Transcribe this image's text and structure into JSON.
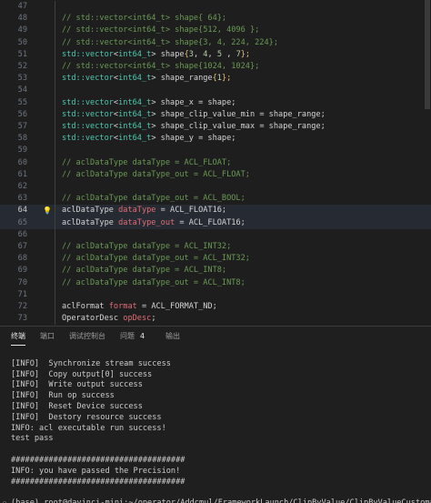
{
  "editor": {
    "lines": [
      {
        "num": "47",
        "tokens": []
      },
      {
        "num": "48",
        "tokens": [
          {
            "t": "// std::vector<int64_t> shape{ 64};",
            "c": "cm"
          }
        ]
      },
      {
        "num": "49",
        "tokens": [
          {
            "t": "// std::vector<int64_t> shape{512, 4096 };",
            "c": "cm"
          }
        ]
      },
      {
        "num": "50",
        "tokens": [
          {
            "t": "// std::vector<int64_t> shape{3, 4, 224, 224};",
            "c": "cm"
          }
        ]
      },
      {
        "num": "51",
        "tokens": [
          {
            "t": "std::",
            "c": "ns"
          },
          {
            "t": "vector",
            "c": "ty"
          },
          {
            "t": "<",
            "c": "pl"
          },
          {
            "t": "int64_t",
            "c": "ty"
          },
          {
            "t": "> ",
            "c": "pl"
          },
          {
            "t": "shape",
            "c": "pl"
          },
          {
            "t": "{",
            "c": "yl"
          },
          {
            "t": "3",
            "c": "nm"
          },
          {
            "t": ", ",
            "c": "pl"
          },
          {
            "t": "4",
            "c": "nm"
          },
          {
            "t": ", ",
            "c": "pl"
          },
          {
            "t": "5",
            "c": "nm"
          },
          {
            "t": " , ",
            "c": "pl"
          },
          {
            "t": "7",
            "c": "nm"
          },
          {
            "t": "};",
            "c": "yl"
          }
        ]
      },
      {
        "num": "52",
        "tokens": [
          {
            "t": "// std::vector<int64_t> shape{1024, 1024};",
            "c": "cm"
          }
        ]
      },
      {
        "num": "53",
        "tokens": [
          {
            "t": "std::",
            "c": "ns"
          },
          {
            "t": "vector",
            "c": "ty"
          },
          {
            "t": "<",
            "c": "pl"
          },
          {
            "t": "int64_t",
            "c": "ty"
          },
          {
            "t": "> ",
            "c": "pl"
          },
          {
            "t": "shape_range",
            "c": "pl"
          },
          {
            "t": "{",
            "c": "yl"
          },
          {
            "t": "1",
            "c": "nm"
          },
          {
            "t": "};",
            "c": "yl"
          }
        ]
      },
      {
        "num": "54",
        "tokens": []
      },
      {
        "num": "55",
        "tokens": [
          {
            "t": "std::",
            "c": "ns"
          },
          {
            "t": "vector",
            "c": "ty"
          },
          {
            "t": "<",
            "c": "pl"
          },
          {
            "t": "int64_t",
            "c": "ty"
          },
          {
            "t": "> shape_x = shape;",
            "c": "pl"
          }
        ]
      },
      {
        "num": "56",
        "tokens": [
          {
            "t": "std::",
            "c": "ns"
          },
          {
            "t": "vector",
            "c": "ty"
          },
          {
            "t": "<",
            "c": "pl"
          },
          {
            "t": "int64_t",
            "c": "ty"
          },
          {
            "t": "> shape_clip_value_min = shape_range;",
            "c": "pl"
          }
        ]
      },
      {
        "num": "57",
        "tokens": [
          {
            "t": "std::",
            "c": "ns"
          },
          {
            "t": "vector",
            "c": "ty"
          },
          {
            "t": "<",
            "c": "pl"
          },
          {
            "t": "int64_t",
            "c": "ty"
          },
          {
            "t": "> shape_clip_value_max = shape_range;",
            "c": "pl"
          }
        ]
      },
      {
        "num": "58",
        "tokens": [
          {
            "t": "std::",
            "c": "ns"
          },
          {
            "t": "vector",
            "c": "ty"
          },
          {
            "t": "<",
            "c": "pl"
          },
          {
            "t": "int64_t",
            "c": "ty"
          },
          {
            "t": "> shape_y = shape;",
            "c": "pl"
          }
        ]
      },
      {
        "num": "59",
        "tokens": []
      },
      {
        "num": "60",
        "tokens": [
          {
            "t": "// aclDataType dataType = ACL_FLOAT;",
            "c": "cm"
          }
        ]
      },
      {
        "num": "61",
        "tokens": [
          {
            "t": "// aclDataType dataType_out = ACL_FLOAT;",
            "c": "cm"
          }
        ]
      },
      {
        "num": "62",
        "tokens": []
      },
      {
        "num": "63",
        "tokens": [
          {
            "t": "// aclDataType dataType_out = ACL_BOOL;",
            "c": "cm"
          }
        ]
      },
      {
        "num": "64",
        "current": true,
        "bulb": true,
        "tokens": [
          {
            "t": "aclDataType ",
            "c": "pl"
          },
          {
            "t": "dataType",
            "c": "vr"
          },
          {
            "t": " = ACL_FLOAT16;",
            "c": "pl"
          }
        ]
      },
      {
        "num": "65",
        "tokens": [
          {
            "t": "aclDataType ",
            "c": "pl"
          },
          {
            "t": "dataType_out",
            "c": "vr"
          },
          {
            "t": " = ACL_FLOAT16;",
            "c": "pl"
          }
        ]
      },
      {
        "num": "66",
        "tokens": []
      },
      {
        "num": "67",
        "tokens": [
          {
            "t": "// aclDataType dataType = ACL_INT32;",
            "c": "cm"
          }
        ]
      },
      {
        "num": "68",
        "tokens": [
          {
            "t": "// aclDataType dataType_out = ACL_INT32;",
            "c": "cm"
          }
        ]
      },
      {
        "num": "69",
        "tokens": [
          {
            "t": "// aclDataType dataType = ACL_INT8;",
            "c": "cm"
          }
        ]
      },
      {
        "num": "70",
        "tokens": [
          {
            "t": "// aclDataType dataType_out = ACL_INT8;",
            "c": "cm"
          }
        ]
      },
      {
        "num": "71",
        "tokens": []
      },
      {
        "num": "72",
        "tokens": [
          {
            "t": "aclFormat ",
            "c": "pl"
          },
          {
            "t": "format",
            "c": "vr"
          },
          {
            "t": " = ACL_FORMAT_ND;",
            "c": "pl"
          }
        ]
      },
      {
        "num": "73",
        "tokens": [
          {
            "t": "OperatorDesc ",
            "c": "pl"
          },
          {
            "t": "opDesc",
            "c": "vr"
          },
          {
            "t": ";",
            "c": "pl"
          }
        ]
      }
    ]
  },
  "panel": {
    "tabs": [
      {
        "label": "终端",
        "active": true
      },
      {
        "label": "端口",
        "active": false
      },
      {
        "label": "调试控制台",
        "active": false
      },
      {
        "label": "问题",
        "badge": "4",
        "active": false
      },
      {
        "label": "输出",
        "active": false
      }
    ]
  },
  "terminal": {
    "lines": [
      "",
      "[INFO]  Synchronize stream success",
      "[INFO]  Copy output[0] success",
      "[INFO]  Write output success",
      "[INFO]  Run op success",
      "[INFO]  Reset Device success",
      "[INFO]  Destory resource success",
      "INFO: acl executable run success!",
      "test pass",
      "",
      "#####################################",
      "INFO: you have passed the Precision!",
      "#####################################",
      "",
      "(base) root@davinci-mini:~/operator/Addcmul/FrameworkLaunch/ClipByValue/ClipByValueCustom#"
    ]
  },
  "colors": {
    "comment": "#6a9955",
    "type": "#4ec9b0",
    "variable": "#e06c75",
    "number": "#b5cea8",
    "brace": "#e5c07b",
    "bulb": "#f1c40f"
  },
  "icons": {
    "bulb": "lightbulb-icon",
    "prompt": "circle-marker-icon"
  }
}
